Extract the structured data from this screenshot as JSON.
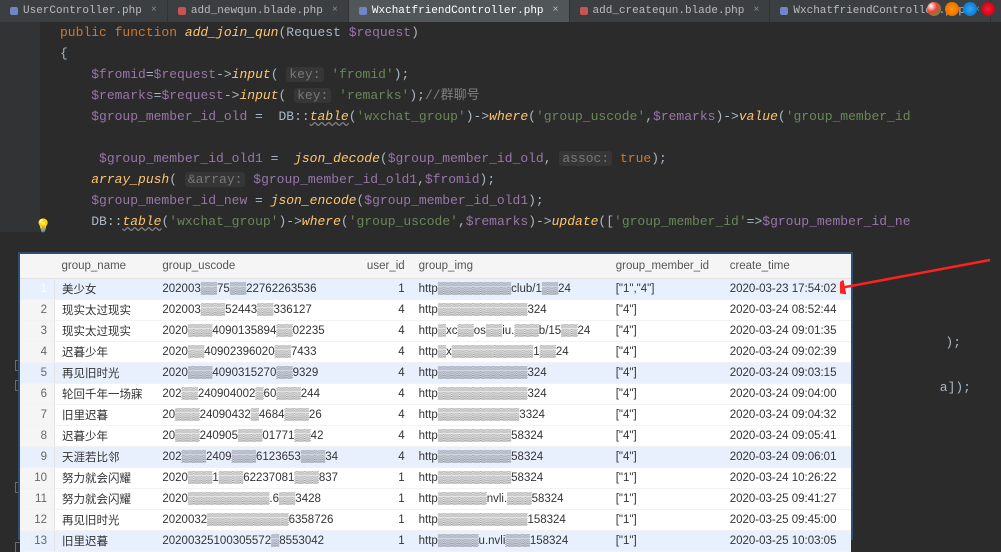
{
  "tabs": [
    {
      "label": "UserController.php",
      "kind": "php",
      "active": false
    },
    {
      "label": "add_newqun.blade.php",
      "kind": "blade",
      "active": false
    },
    {
      "label": "WxchatfriendController.php",
      "kind": "php",
      "active": true
    },
    {
      "label": "add_createqun.blade.php",
      "kind": "blade",
      "active": false
    },
    {
      "label": "WxchatfriendController.php",
      "kind": "php",
      "active": false
    }
  ],
  "code": {
    "l1a": "public function",
    "l1b": " add_join_qun",
    "l1c": "Request ",
    "l1d": "$request",
    "l2": "{",
    "l3a": "$fromid",
    "l3b": "=",
    "l3c": "$request",
    "l3d": "->",
    "l3e": "input",
    "l3f": "key:",
    "l3g": "'fromid'",
    "l4a": "$remarks",
    "l4b": "=",
    "l4c": "$request",
    "l4d": "->",
    "l4e": "input",
    "l4f": "key:",
    "l4g": "'remarks'",
    "l4h": "//群聊号",
    "l5a": "$group_member_id_old",
    "l5b": " =  ",
    "l5c": "DB",
    "l5d": "::",
    "l5e": "table",
    "l5f": "'wxchat_group'",
    "l5g": "->",
    "l5h": "where",
    "l5i": "'group_uscode'",
    "l5j": ",",
    "l5k": "$remarks",
    "l5l": "->",
    "l5m": "value",
    "l5n": "'group_member_id",
    "l7a": "$group_member_id_old1",
    "l7b": " =  ",
    "l7c": "json_decode",
    "l7d": "$group_member_id_old",
    "l7e": ", ",
    "l7f": "assoc:",
    "l7g": "true",
    "l8a": "array_push",
    "l8b": "&array:",
    "l8c": "$group_member_id_old1",
    "l8d": ",",
    "l8e": "$fromid",
    "l9a": "$group_member_id_new",
    "l9b": " = ",
    "l9c": "json_encode",
    "l9d": "$group_member_id_old1",
    "l10a": "DB",
    "l10b": "::",
    "l10c": "table",
    "l10d": "'wxchat_group'",
    "l10e": "->",
    "l10f": "where",
    "l10g": "'group_uscode'",
    "l10h": ",",
    "l10i": "$remarks",
    "l10j": "->",
    "l10k": "update",
    "l10l": "'group_member_id'",
    "l10m": "=>",
    "l10n": "$group_member_id_ne",
    "tail1": ");",
    "tail2": "a]);"
  },
  "columns": [
    "",
    "group_name",
    "group_uscode",
    "user_id",
    "group_img",
    "group_member_id",
    "create_time"
  ],
  "rows": [
    {
      "n": "1",
      "name": "美少女",
      "usc": "202003▒▒75▒▒22762263536",
      "uid": "1",
      "img": "http▒▒▒▒▒▒▒▒▒club/1▒▒24",
      "mid": "[\"1\",\"4\"]",
      "ct": "2020-03-23 17:54:02",
      "hl": true
    },
    {
      "n": "2",
      "name": "现实太过现实",
      "usc": "202003▒▒▒52443▒▒336127",
      "uid": "4",
      "img": "http▒▒▒▒▒▒▒▒▒▒▒324",
      "mid": "[\"4\"]",
      "ct": "2020-03-24 08:52:44"
    },
    {
      "n": "3",
      "name": "现实太过现实",
      "usc": "2020▒▒▒4090135894▒▒02235",
      "uid": "4",
      "img": "http▒xc▒▒os▒▒iu.▒▒▒b/15▒▒24",
      "mid": "[\"4\"]",
      "ct": "2020-03-24 09:01:35"
    },
    {
      "n": "4",
      "name": "迟暮少年",
      "usc": "2020▒▒40902396020▒▒7433",
      "uid": "4",
      "img": "http▒x▒▒▒▒▒▒▒▒▒▒1▒▒24",
      "mid": "[\"4\"]",
      "ct": "2020-03-24 09:02:39"
    },
    {
      "n": "5",
      "name": "再见旧时光",
      "usc": "2020▒▒▒4090315270▒▒9329",
      "uid": "4",
      "img": "http▒▒▒▒▒▒▒▒▒▒▒324",
      "mid": "[\"4\"]",
      "ct": "2020-03-24 09:03:15",
      "hl": true
    },
    {
      "n": "6",
      "name": "轮回千年一场寐",
      "usc": "202▒▒240904002▒60▒▒▒244",
      "uid": "4",
      "img": "http▒▒▒▒▒▒▒▒▒▒▒324",
      "mid": "[\"4\"]",
      "ct": "2020-03-24 09:04:00"
    },
    {
      "n": "7",
      "name": "旧里迟暮",
      "usc": "20▒▒▒24090432▒4684▒▒▒26",
      "uid": "4",
      "img": "http▒▒▒▒▒▒▒▒▒▒3324",
      "mid": "[\"4\"]",
      "ct": "2020-03-24 09:04:32"
    },
    {
      "n": "8",
      "name": "迟暮少年",
      "usc": "20▒▒▒240905▒▒▒01771▒▒42",
      "uid": "4",
      "img": "http▒▒▒▒▒▒▒▒▒58324",
      "mid": "[\"4\"]",
      "ct": "2020-03-24 09:05:41"
    },
    {
      "n": "9",
      "name": "天涯若比邻",
      "usc": "202▒▒▒2409▒▒▒6123653▒▒▒34",
      "uid": "4",
      "img": "http▒▒▒▒▒▒▒▒▒58324",
      "mid": "[\"4\"]",
      "ct": "2020-03-24 09:06:01",
      "hl": true
    },
    {
      "n": "10",
      "name": "努力就会闪耀",
      "usc": "2020▒▒▒1▒▒▒62237081▒▒▒837",
      "uid": "1",
      "img": "http▒▒▒▒▒▒▒▒▒58324",
      "mid": "[\"1\"]",
      "ct": "2020-03-24 10:26:22"
    },
    {
      "n": "11",
      "name": "努力就会闪耀",
      "usc": "2020▒▒▒▒▒▒▒▒▒▒.6▒▒3428",
      "uid": "1",
      "img": "http▒▒▒▒▒▒nvli.▒▒▒58324",
      "mid": "[\"1\"]",
      "ct": "2020-03-25 09:41:27"
    },
    {
      "n": "12",
      "name": "再见旧时光",
      "usc": "2020032▒▒▒▒▒▒▒▒▒▒6358726",
      "uid": "1",
      "img": "http▒▒▒▒▒▒▒▒▒▒▒158324",
      "mid": "[\"1\"]",
      "ct": "2020-03-25 09:45:00"
    },
    {
      "n": "13",
      "name": "旧里迟暮",
      "usc": "20200325100305572▒8553042",
      "uid": "1",
      "img": "http▒▒▒▒▒u.nvli▒▒▒158324",
      "mid": "[\"1\"]",
      "ct": "2020-03-25 10:03:05",
      "hl": true
    }
  ]
}
